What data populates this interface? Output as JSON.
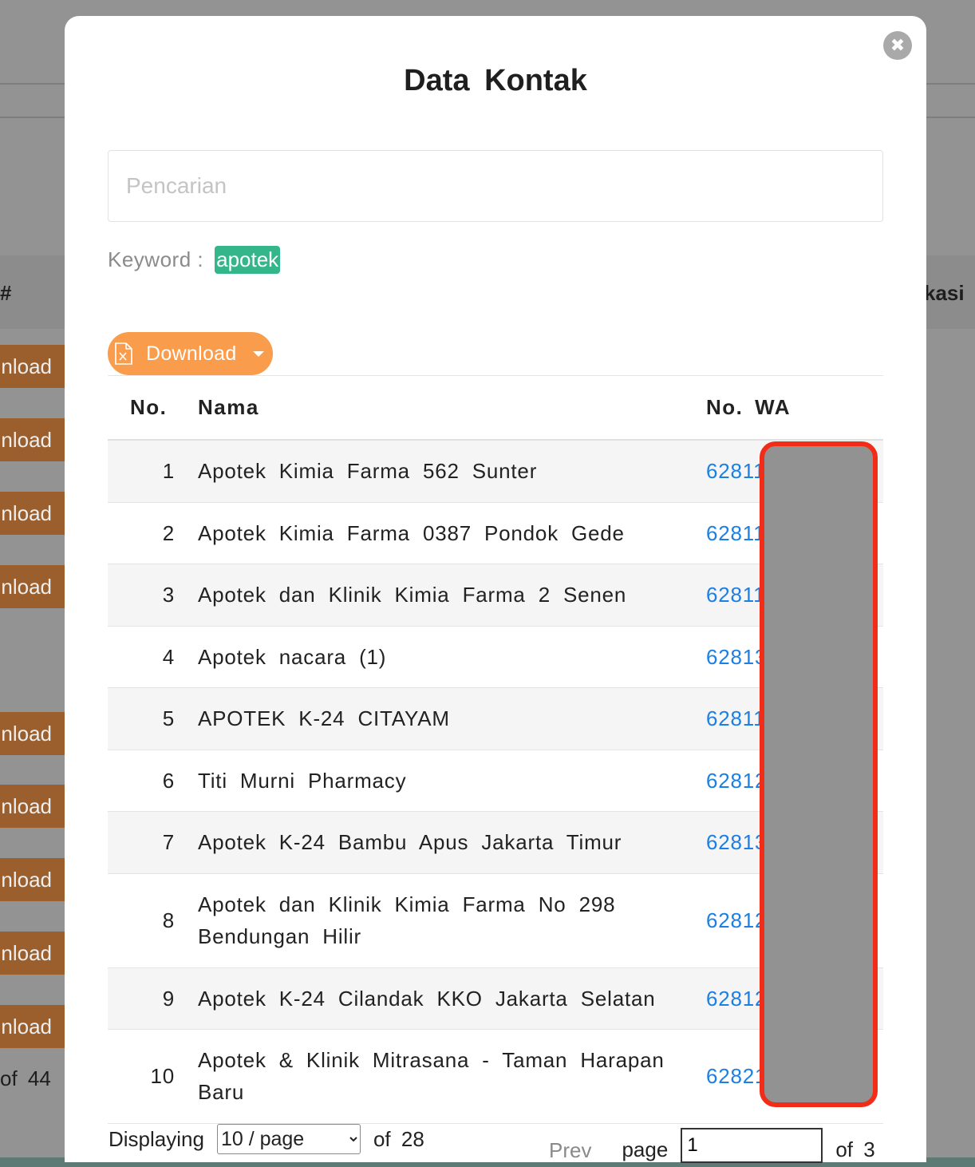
{
  "background": {
    "header_hash": "#",
    "header_right": "kasi",
    "row_button_label": "nload",
    "footer_text": "of  44"
  },
  "modal": {
    "title": "Data  Kontak",
    "close_icon": "close-icon",
    "search": {
      "placeholder": "Pencarian",
      "value": ""
    },
    "keyword": {
      "label": "Keyword :",
      "tag": "apotek"
    },
    "download": {
      "label": "Download",
      "icon": "excel-file-icon",
      "dropdown_icon": "caret-down-icon"
    },
    "table": {
      "headers": {
        "no": "No.",
        "nama": "Nama",
        "wa": "No. WA"
      },
      "rows": [
        {
          "no": "1",
          "nama": "Apotek Kimia Farma 562 Sunter",
          "wa": "62811"
        },
        {
          "no": "2",
          "nama": "Apotek Kimia Farma 0387 Pondok Gede",
          "wa": "62811"
        },
        {
          "no": "3",
          "nama": "Apotek dan Klinik Kimia Farma 2 Senen",
          "wa": "62811"
        },
        {
          "no": "4",
          "nama": "Apotek nacara (1)",
          "wa": "62813"
        },
        {
          "no": "5",
          "nama": "APOTEK K-24 CITAYAM",
          "wa": "62811"
        },
        {
          "no": "6",
          "nama": "Titi Murni Pharmacy",
          "wa": "62812"
        },
        {
          "no": "7",
          "nama": "Apotek K-24 Bambu Apus Jakarta Timur",
          "wa": "62813"
        },
        {
          "no": "8",
          "nama": "Apotek dan Klinik Kimia Farma No 298 Bendungan Hilir",
          "wa": "62812"
        },
        {
          "no": "9",
          "nama": "Apotek K-24 Cilandak KKO Jakarta Selatan",
          "wa": "62812"
        },
        {
          "no": "10",
          "nama": "Apotek & Klinik Mitrasana - Taman Harapan Baru",
          "wa": "62821"
        }
      ]
    },
    "footer": {
      "displaying_label": "Displaying",
      "page_size_selected": "10 / page",
      "page_size_options": [
        "10 / page"
      ],
      "of_total": "of  28",
      "prev_label": "Prev",
      "page_label": "page",
      "page_value": "1",
      "of_pages": "of  3"
    }
  }
}
